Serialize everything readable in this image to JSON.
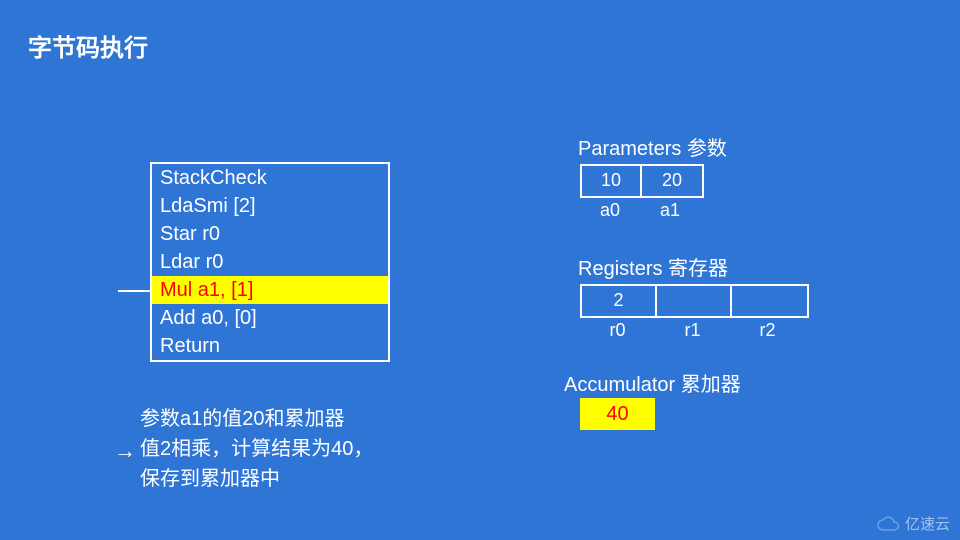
{
  "title": "字节码执行",
  "bytecode": {
    "lines": [
      "StackCheck",
      "LdaSmi [2]",
      "Star r0",
      "Ldar r0",
      "Mul a1, [1]",
      "Add a0, [0]",
      "Return"
    ],
    "highlight_index": 4
  },
  "note": {
    "line1": "参数a1的值20和累加器",
    "line2": "值2相乘，计算结果为40，",
    "line3": "保存到累加器中"
  },
  "parameters": {
    "label": "Parameters 参数",
    "values": [
      "10",
      "20"
    ],
    "names": [
      "a0",
      "a1"
    ]
  },
  "registers": {
    "label": "Registers 寄存器",
    "values": [
      "2",
      "",
      ""
    ],
    "names": [
      "r0",
      "r1",
      "r2"
    ]
  },
  "accumulator": {
    "label": "Accumulator 累加器",
    "value": "40"
  },
  "watermark": "亿速云",
  "chart_data": {
    "type": "table",
    "title": "字节码执行 (Bytecode Execution)",
    "bytecode_instructions": [
      "StackCheck",
      "LdaSmi [2]",
      "Star r0",
      "Ldar r0",
      "Mul a1, [1]",
      "Add a0, [0]",
      "Return"
    ],
    "current_instruction": "Mul a1, [1]",
    "current_instruction_index": 4,
    "annotation": "参数a1的值20和累加器值2相乘，计算结果为40，保存到累加器中",
    "state": {
      "parameters": {
        "a0": 10,
        "a1": 20
      },
      "registers": {
        "r0": 2,
        "r1": null,
        "r2": null
      },
      "accumulator": 40
    }
  }
}
